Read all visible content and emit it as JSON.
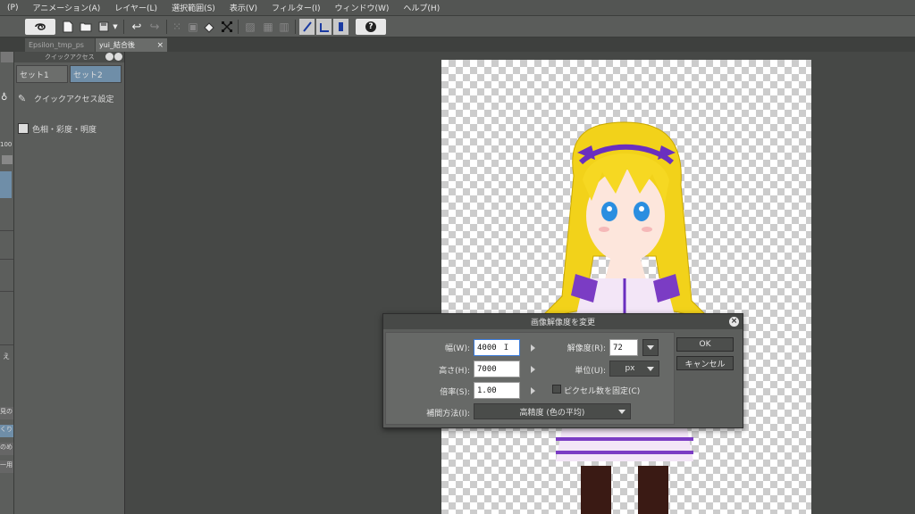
{
  "menu": {
    "items": [
      "(P)",
      "アニメーション(A)",
      "レイヤー(L)",
      "選択範囲(S)",
      "表示(V)",
      "フィルター(I)",
      "ウィンドウ(W)",
      "ヘルプ(H)"
    ]
  },
  "toolbar": {
    "icons": [
      "clipstudio-icon",
      "new-file-icon",
      "open-folder-icon",
      "save-icon",
      "dropdown-icon",
      "undo-icon",
      "redo-icon",
      "select-icon",
      "transform-icon",
      "fill-icon",
      "crop-icon",
      "ruler-icon",
      "guide-icon",
      "snap-icon",
      "snap-ruler-icon",
      "snap-special-icon",
      "snap-grid-icon",
      "help-icon"
    ],
    "help_label": "?"
  },
  "tabs": [
    {
      "label": "Epsilon_tmp_ps",
      "active": false
    },
    {
      "label": "yui_結合後",
      "active": true
    }
  ],
  "tab_close": "×",
  "quick_access": {
    "header": "クイックアクセス",
    "sets": [
      "セット1",
      "セット2"
    ],
    "items": [
      {
        "label": "クイックアクセス設定",
        "icon": "wrench-icon"
      },
      {
        "label": "色相・彩度・明度",
        "icon": "hsv-icon"
      }
    ]
  },
  "left_strip": {
    "labels": [
      "100",
      "え",
      "見の",
      "くり",
      "のめ",
      "一用"
    ]
  },
  "dialog": {
    "title": "画像解像度を変更",
    "close": "×",
    "width_label": "幅(W):",
    "width_value": "4000",
    "height_label": "高さ(H):",
    "height_value": "7000",
    "scale_label": "倍率(S):",
    "scale_value": "1.00",
    "resolution_label": "解像度(R):",
    "resolution_value": "72",
    "unit_label": "単位(U):",
    "unit_value": "px",
    "fix_pixels_label": "ピクセル数を固定(C)",
    "fix_pixels_checked": false,
    "interp_label": "補間方法(I):",
    "interp_value": "高精度 (色の平均)",
    "ok": "OK",
    "cancel": "キャンセル"
  }
}
